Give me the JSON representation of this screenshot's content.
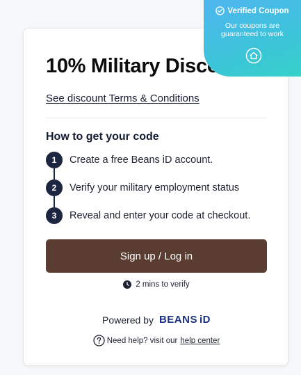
{
  "badge": {
    "title": "Verified Coupon",
    "subtitle_line1": "Our coupons are",
    "subtitle_line2": "guaranteed to work"
  },
  "card": {
    "title": "10% Military Discount",
    "terms_link": "See discount Terms & Conditions",
    "steps_heading": "How to get your code",
    "steps": [
      {
        "number": "1",
        "text": "Create a free Beans iD account."
      },
      {
        "number": "2",
        "text": "Verify your military employment status"
      },
      {
        "number": "3",
        "text": "Reveal and enter your code at checkout."
      }
    ],
    "cta_label": "Sign up / Log in",
    "verify_time": "2 mins to verify",
    "powered_by": "Powered by",
    "brand": "BEANS",
    "brand_suffix": "iD",
    "help_text": "Need help? visit our",
    "help_link": "help center"
  },
  "colors": {
    "cta_background": "#5a3c30",
    "step_badge": "#1c2640",
    "brand_blue": "#1b2f80",
    "badge_gradient_start": "#4fb6f0",
    "badge_gradient_end": "#35d2c8"
  }
}
